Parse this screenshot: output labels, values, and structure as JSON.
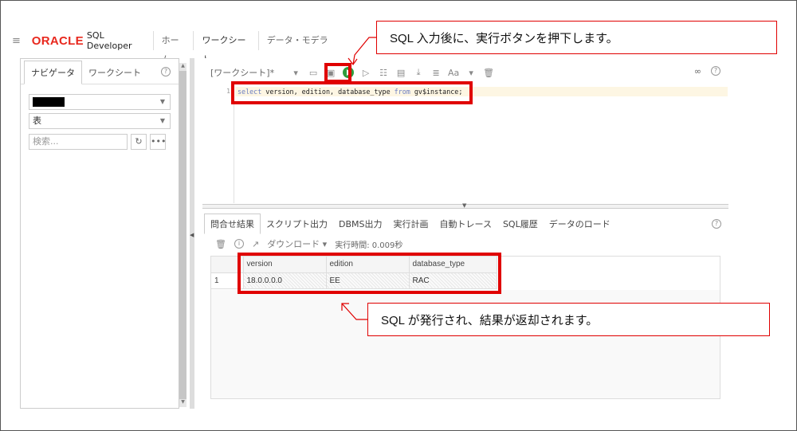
{
  "app": {
    "brand": "ORACLE",
    "product": "SQL Developer",
    "menu_icon": "hamburger-icon",
    "tabs": [
      {
        "label": "ホーム",
        "active": false
      },
      {
        "label": "ワークシート",
        "active": true
      },
      {
        "label": "データ・モデラー",
        "active": false
      }
    ]
  },
  "navigator": {
    "tabs": [
      {
        "label": "ナビゲータ",
        "active": true
      },
      {
        "label": "ワークシート",
        "active": false
      }
    ],
    "help_icon": "help-icon",
    "schema_value": "",
    "type_value": "表",
    "search_placeholder": "検索..."
  },
  "worksheet": {
    "title": "[ワークシート]*",
    "toolbar_icons": [
      "open-icon",
      "save-icon",
      "run-statement-icon",
      "run-script-icon",
      "explain-plan-icon",
      "autotrace-icon",
      "download-icon",
      "format-icon",
      "case-icon",
      "clear-icon"
    ],
    "line_number": "1",
    "code": {
      "kw_select": "select",
      "columns": " version, edition, database_type ",
      "kw_from": "from",
      "table": " gv$instance;"
    }
  },
  "results": {
    "tabs": [
      {
        "label": "問合せ結果",
        "active": true
      },
      {
        "label": "スクリプト出力",
        "active": false
      },
      {
        "label": "DBMS出力",
        "active": false
      },
      {
        "label": "実行計画",
        "active": false
      },
      {
        "label": "自動トレース",
        "active": false
      },
      {
        "label": "SQL履歴",
        "active": false
      },
      {
        "label": "データのロード",
        "active": false
      }
    ],
    "download_label": "ダウンロード",
    "exec_time": "実行時間: 0.009秒",
    "columns": [
      "version",
      "edition",
      "database_type"
    ],
    "rows": [
      {
        "num": "1",
        "cells": [
          "18.0.0.0.0",
          "EE",
          "RAC"
        ]
      }
    ]
  },
  "annotations": {
    "callout_run": "SQL 入力後に、実行ボタンを押下します。",
    "callout_result": "SQL が発行され、結果が返却されます。",
    "accent_color": "#e00000"
  }
}
